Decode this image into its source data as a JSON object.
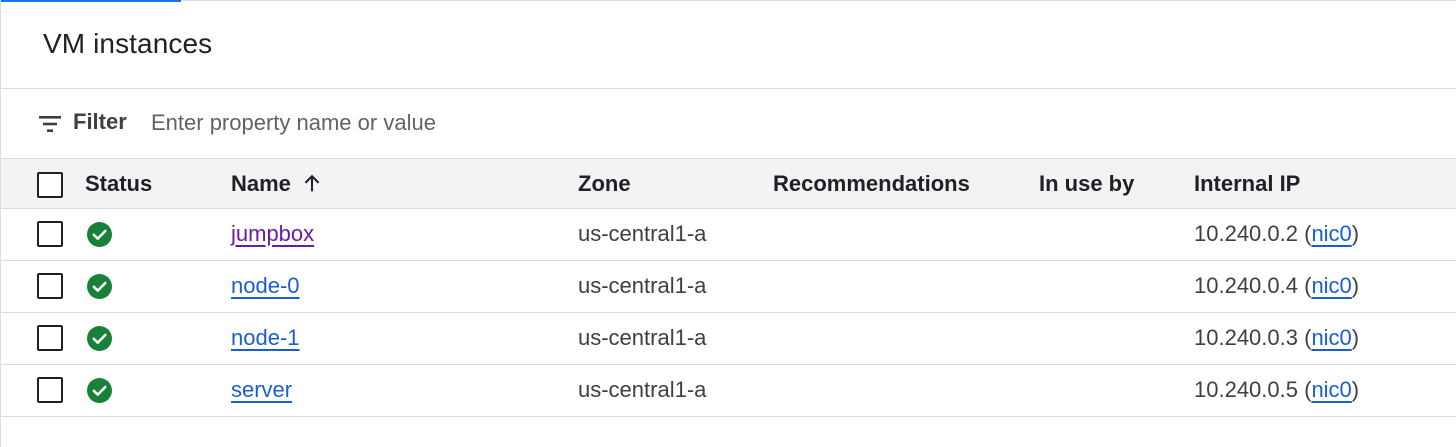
{
  "page": {
    "title": "VM instances"
  },
  "filter": {
    "label": "Filter",
    "placeholder": "Enter property name or value",
    "icon": "filter-list-icon"
  },
  "table": {
    "columns": {
      "status": "Status",
      "name": "Name",
      "zone": "Zone",
      "recommendations": "Recommendations",
      "in_use_by": "In use by",
      "internal_ip": "Internal IP"
    },
    "sort": {
      "column": "Name",
      "direction": "ascending",
      "icon": "arrow-upward-icon"
    },
    "rows": [
      {
        "status": "running",
        "status_icon": "check-circle-icon",
        "name": "jumpbox",
        "name_visited": true,
        "zone": "us-central1-a",
        "recommendations": "",
        "in_use_by": "",
        "ip": "10.240.0.2",
        "nic": "nic0"
      },
      {
        "status": "running",
        "status_icon": "check-circle-icon",
        "name": "node-0",
        "name_visited": false,
        "zone": "us-central1-a",
        "recommendations": "",
        "in_use_by": "",
        "ip": "10.240.0.4",
        "nic": "nic0"
      },
      {
        "status": "running",
        "status_icon": "check-circle-icon",
        "name": "node-1",
        "name_visited": false,
        "zone": "us-central1-a",
        "recommendations": "",
        "in_use_by": "",
        "ip": "10.240.0.3",
        "nic": "nic0"
      },
      {
        "status": "running",
        "status_icon": "check-circle-icon",
        "name": "server",
        "name_visited": false,
        "zone": "us-central1-a",
        "recommendations": "",
        "in_use_by": "",
        "ip": "10.240.0.5",
        "nic": "nic0"
      }
    ]
  },
  "colors": {
    "accent": "#1a73e8",
    "link": "#1a5fd0",
    "visited_link": "#681da8",
    "status_ok": "#188038",
    "header_bg": "#f1f3f4",
    "divider": "#dadce0"
  }
}
